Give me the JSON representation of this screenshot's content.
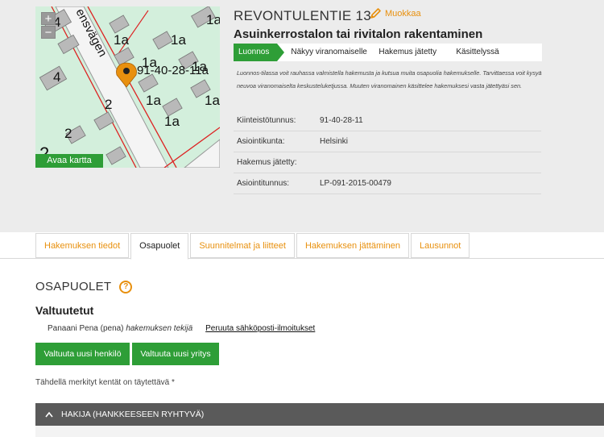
{
  "map": {
    "zoom_in": "+",
    "zoom_out": "−",
    "open_map": "Avaa kartta",
    "street_label": "ensvägen",
    "parcel_label": "91-40-28-11a",
    "lot_labels": [
      "4",
      "1a",
      "1a",
      "1a",
      "4",
      "1a",
      "1a",
      "1a",
      "1a",
      "2",
      "2",
      "1a",
      "2"
    ],
    "pin_color": "#e8900e"
  },
  "header": {
    "street": "REVONTULENTIE 13",
    "edit_label": "Muokkaa",
    "operation": "Asuinkerrostalon tai rivitalon rakentaminen"
  },
  "steps": [
    "Luonnos",
    "Näkyy viranomaiselle",
    "Hakemus jätetty",
    "Käsittelyssä"
  ],
  "note": "Luonnos-tilassa voit rauhassa valmistella hakemusta ja kutsua muita osapuolia hakemukselle. Tarvittaessa voit kysyä neuvoa viranomaiselta keskusteluketjussa. Muuten viranomainen käsittelee hakemuksesi vasta jätettyäsi sen.",
  "props": [
    {
      "label": "Kiinteistötunnus:",
      "value": "91-40-28-11"
    },
    {
      "label": "Asiointikunta:",
      "value": "Helsinki"
    },
    {
      "label": "Hakemus jätetty:",
      "value": ""
    },
    {
      "label": "Asiointitunnus:",
      "value": "LP-091-2015-00479"
    }
  ],
  "tabs": [
    "Hakemuksen tiedot",
    "Osapuolet",
    "Suunnitelmat ja liitteet",
    "Hakemuksen jättäminen",
    "Lausunnot"
  ],
  "parties": {
    "title": "OSAPUOLET",
    "help": "?",
    "authorized_heading": "Valtuutetut",
    "person": "Panaani Pena (pena)",
    "role": "hakemuksen tekijä",
    "unsubscribe": "Peruuta sähköposti-ilmoitukset",
    "btn_person": "Valtuuta uusi henkilö",
    "btn_company": "Valtuuta uusi yritys",
    "required_note": "Tähdellä merkityt kentät on täytettävä *",
    "accordion": "HAKIJA (HANKKEESEEN RYHTYVÄ)"
  },
  "colors": {
    "accent": "#e8900e",
    "green": "#2e9e37",
    "dark": "#5a5a5a"
  }
}
